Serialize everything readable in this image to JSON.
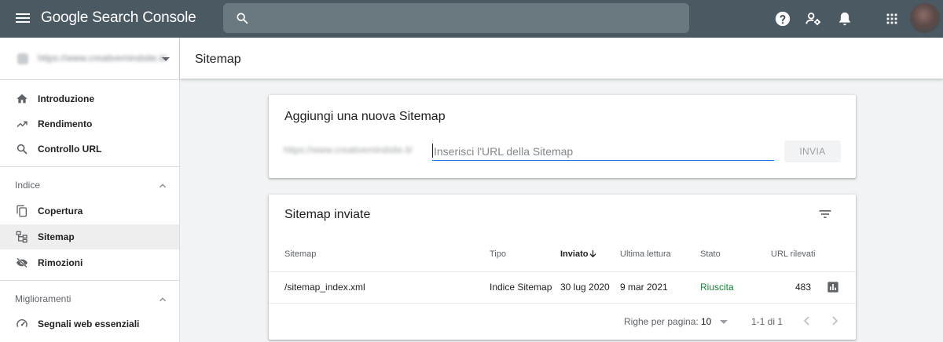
{
  "app": {
    "title": "Google Search Console"
  },
  "header": {
    "search_placeholder": "",
    "icons": [
      "menu-icon",
      "search-icon",
      "help-icon",
      "manage-users-icon",
      "notifications-icon",
      "apps-grid-icon",
      "account-avatar"
    ]
  },
  "sidebar": {
    "property_url": "https://www.creativemindsite.it/",
    "items": [
      {
        "label": "Introduzione",
        "icon": "home-icon"
      },
      {
        "label": "Rendimento",
        "icon": "trending-up-icon"
      },
      {
        "label": "Controllo URL",
        "icon": "search-icon"
      }
    ],
    "sections": [
      {
        "label": "Indice",
        "items": [
          {
            "label": "Copertura",
            "icon": "copy-pages-icon"
          },
          {
            "label": "Sitemap",
            "icon": "sitemap-tree-icon",
            "active": true
          },
          {
            "label": "Rimozioni",
            "icon": "visibility-off-icon"
          }
        ]
      },
      {
        "label": "Miglioramenti",
        "items": [
          {
            "label": "Segnali web essenziali",
            "icon": "speed-gauge-icon"
          }
        ]
      }
    ]
  },
  "page": {
    "title": "Sitemap"
  },
  "add_sitemap": {
    "title": "Aggiungi una nuova Sitemap",
    "url_prefix": "https://www.creativemindsite.it/",
    "input_placeholder": "Inserisci l'URL della Sitemap",
    "input_value": "",
    "submit_label": "INVIA"
  },
  "submitted": {
    "title": "Sitemap inviate",
    "columns": {
      "sitemap": "Sitemap",
      "type": "Tipo",
      "submitted": "Inviato",
      "last_read": "Ultima lettura",
      "status": "Stato",
      "urls": "URL rilevati"
    },
    "sort_column": "submitted",
    "sort_direction": "desc",
    "rows": [
      {
        "sitemap": "/sitemap_index.xml",
        "type": "Indice Sitemap",
        "submitted": "30 lug 2020",
        "last_read": "9 mar 2021",
        "status": "Riuscita",
        "urls": "483"
      }
    ],
    "footer": {
      "rows_per_page_label": "Righe per pagina:",
      "rows_per_page_value": "10",
      "range": "1-1 di 1"
    }
  },
  "colors": {
    "appbar": "#4a5962",
    "search_field": "#6a787f",
    "accent": "#1a73e8",
    "status_success": "#188038"
  }
}
